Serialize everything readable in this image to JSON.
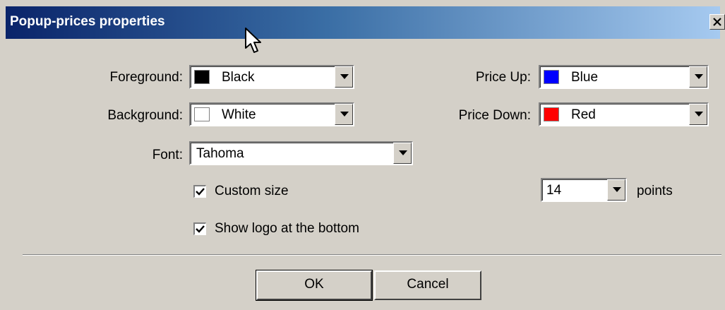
{
  "window": {
    "title": "Popup-prices properties",
    "close_glyph": "✕"
  },
  "fields": {
    "foreground": {
      "label": "Foreground:",
      "value": "Black",
      "color": "#000000"
    },
    "background": {
      "label": "Background:",
      "value": "White",
      "color": "#ffffff"
    },
    "price_up": {
      "label": "Price Up:",
      "value": "Blue",
      "color": "#0000ff"
    },
    "price_down": {
      "label": "Price Down:",
      "value": "Red",
      "color": "#ff0000"
    },
    "font": {
      "label": "Font:",
      "value": "Tahoma"
    }
  },
  "options": {
    "custom_size": {
      "label": "Custom size",
      "checked": true
    },
    "size_value": "14",
    "size_unit": "points",
    "show_logo": {
      "label": "Show logo at the bottom",
      "checked": true
    }
  },
  "buttons": {
    "ok": "OK",
    "cancel": "Cancel"
  },
  "icons": {
    "close": "close-icon",
    "dropdown": "chevron-down-icon",
    "check": "checkmark-icon",
    "cursor": "mouse-pointer-icon"
  }
}
